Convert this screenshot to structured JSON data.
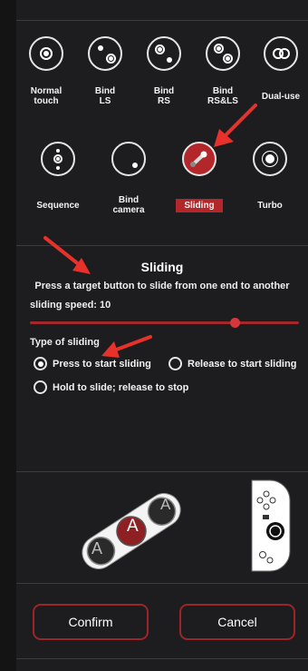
{
  "modes_row1": [
    {
      "label": "Normal\ntouch",
      "icon": "normal-touch-icon"
    },
    {
      "label": "Bind\nLS",
      "icon": "bind-ls-icon"
    },
    {
      "label": "Bind\nRS",
      "icon": "bind-rs-icon"
    },
    {
      "label": "Bind\nRS&LS",
      "icon": "bind-rs-ls-icon"
    },
    {
      "label": "Dual-use",
      "icon": "dual-use-icon"
    }
  ],
  "modes_row2": [
    {
      "label": "Sequence",
      "icon": "sequence-icon"
    },
    {
      "label": "Bind\ncamera",
      "icon": "bind-camera-icon"
    },
    {
      "label": "Sliding",
      "icon": "sliding-icon",
      "selected": true
    },
    {
      "label": "Turbo",
      "icon": "turbo-icon"
    }
  ],
  "settings": {
    "title": "Sliding",
    "description": "Press a target button to slide from one end to another",
    "speed_label": "sliding speed: 10",
    "speed_value": 10,
    "speed_fraction": 0.76,
    "type_label": "Type of sliding",
    "options": [
      {
        "label": "Press to start sliding",
        "selected": true
      },
      {
        "label": "Release to start sliding",
        "selected": false
      },
      {
        "label": "Hold to slide; release to stop",
        "selected": false
      }
    ]
  },
  "preview": {
    "button_letter": "A"
  },
  "actions": {
    "confirm": "Confirm",
    "cancel": "Cancel"
  },
  "colors": {
    "accent": "#b3262a",
    "panel": "#1d1d1f",
    "arrow": "#e8312a"
  }
}
